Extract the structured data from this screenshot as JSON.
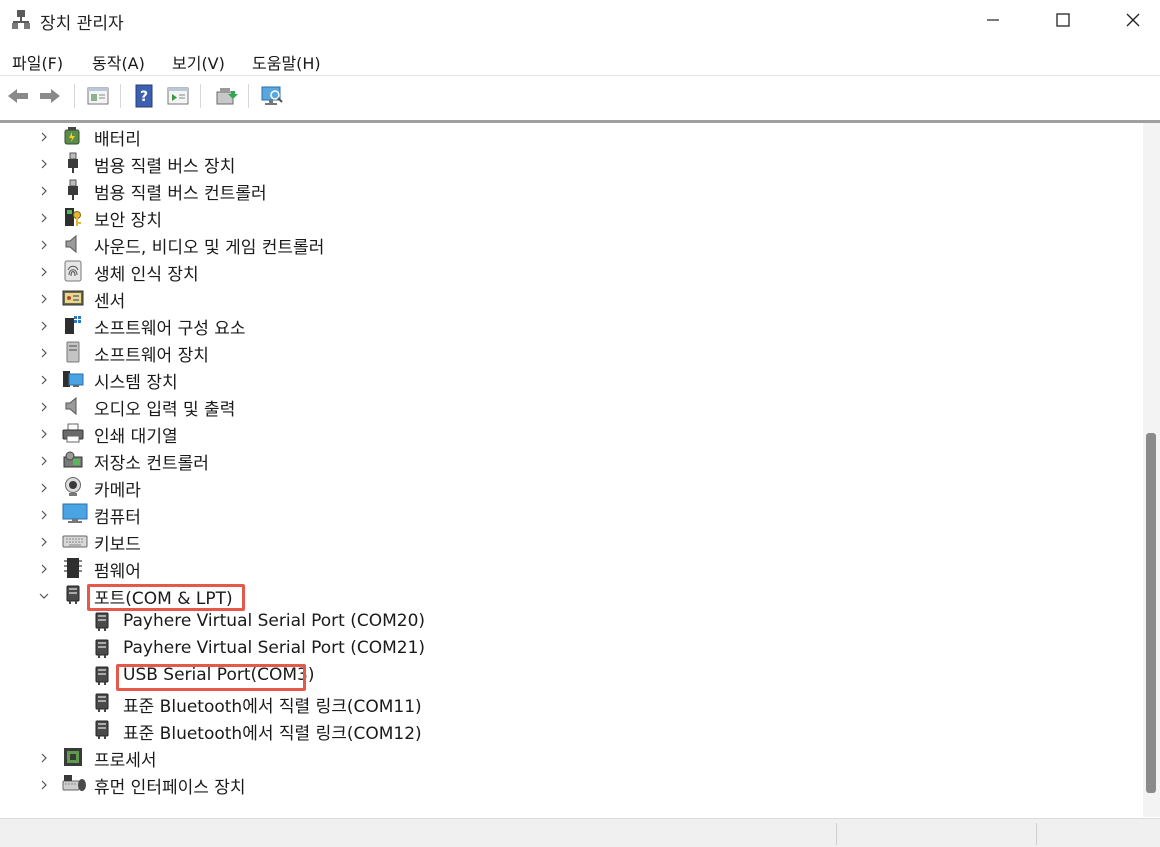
{
  "window": {
    "title": "장치 관리자"
  },
  "menu": [
    {
      "label": "파일(F)"
    },
    {
      "label": "동작(A)"
    },
    {
      "label": "보기(V)"
    },
    {
      "label": "도움말(H)"
    }
  ],
  "toolbar": {
    "buttons": [
      "back-icon",
      "forward-icon",
      "properties-icon",
      "help-icon",
      "run-icon",
      "update-driver-icon",
      "scan-hardware-icon"
    ]
  },
  "tree": {
    "categories": [
      {
        "label": "배터리",
        "icon": "battery-icon"
      },
      {
        "label": "범용 직렬 버스 장치",
        "icon": "usb-icon"
      },
      {
        "label": "범용 직렬 버스 컨트롤러",
        "icon": "usb-icon"
      },
      {
        "label": "보안 장치",
        "icon": "security-key-icon"
      },
      {
        "label": "사운드, 비디오 및 게임 컨트롤러",
        "icon": "speaker-icon"
      },
      {
        "label": "생체 인식 장치",
        "icon": "fingerprint-icon"
      },
      {
        "label": "센서",
        "icon": "sensor-icon"
      },
      {
        "label": "소프트웨어 구성 요소",
        "icon": "software-component-icon"
      },
      {
        "label": "소프트웨어 장치",
        "icon": "software-device-icon"
      },
      {
        "label": "시스템 장치",
        "icon": "system-device-icon"
      },
      {
        "label": "오디오 입력 및 출력",
        "icon": "speaker-icon"
      },
      {
        "label": "인쇄 대기열",
        "icon": "printer-icon"
      },
      {
        "label": "저장소 컨트롤러",
        "icon": "storage-controller-icon"
      },
      {
        "label": "카메라",
        "icon": "camera-icon"
      },
      {
        "label": "컴퓨터",
        "icon": "monitor-icon"
      },
      {
        "label": "키보드",
        "icon": "keyboard-icon"
      },
      {
        "label": "펌웨어",
        "icon": "firmware-icon"
      },
      {
        "label": "포트(COM & LPT)",
        "icon": "port-icon",
        "expanded": true
      },
      {
        "label": "프로세서",
        "icon": "processor-icon"
      },
      {
        "label": "휴먼 인터페이스 장치",
        "icon": "hid-icon"
      }
    ],
    "ports_children": [
      {
        "label": "Payhere Virtual Serial Port (COM20)"
      },
      {
        "label": "Payhere Virtual Serial Port (COM21)"
      },
      {
        "label": "USB Serial Port(COM3)",
        "highlighted": true
      },
      {
        "label": "표준 Bluetooth에서 직렬 링크(COM11)"
      },
      {
        "label": "표준 Bluetooth에서 직렬 링크(COM12)"
      }
    ]
  },
  "colors": {
    "highlight": "#e4594a",
    "accent": "#1e73be"
  }
}
